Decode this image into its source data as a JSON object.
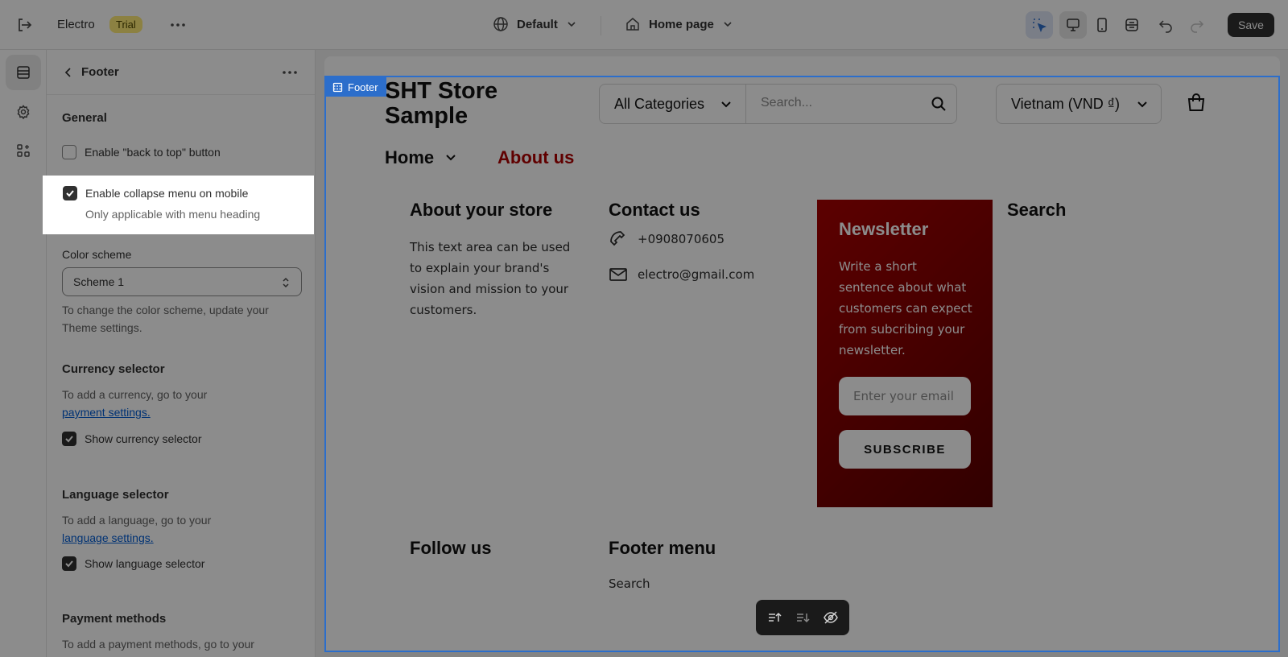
{
  "topbar": {
    "store_name": "Electro",
    "trial_badge": "Trial",
    "theme_label": "Default",
    "page_label": "Home page",
    "save_label": "Save"
  },
  "panel": {
    "title": "Footer",
    "general_heading": "General",
    "back_to_top_label": "Enable \"back to top\" button",
    "collapse_label": "Enable collapse menu on mobile",
    "collapse_hint": "Only applicable with menu heading",
    "color_scheme_label": "Color scheme",
    "color_scheme_value": "Scheme 1",
    "color_scheme_hint": "To change the color scheme, update your Theme settings.",
    "currency_heading": "Currency selector",
    "currency_hint": "To add a currency, go to your",
    "currency_link": "payment settings.",
    "show_currency_label": "Show currency selector",
    "language_heading": "Language selector",
    "language_hint": "To add a language, go to your",
    "language_link": "language settings.",
    "show_language_label": "Show language selector",
    "payment_heading": "Payment methods",
    "payment_hint": "To add a payment methods, go to your"
  },
  "preview": {
    "store_name": "SHT Store Sample",
    "categories_label": "All Categories",
    "search_placeholder": "Search...",
    "currency_label": "Vietnam (VND ₫)",
    "nav_home": "Home",
    "nav_about": "About us",
    "about_heading": "About your store",
    "about_text": "This text area can be used to explain your brand's vision and mission to your customers.",
    "contact_heading": "Contact us",
    "phone": "+0908070605",
    "email": "electro@gmail.com",
    "newsletter_heading": "Newsletter",
    "newsletter_text": "Write a short sentence about what customers can expect from subcribing your newsletter.",
    "newsletter_placeholder": "Enter your email",
    "subscribe_label": "SUBSCRIBE",
    "search_heading": "Search",
    "follow_heading": "Follow us",
    "footer_menu_heading": "Footer menu",
    "footer_menu_item": "Search"
  },
  "selection_tag": "Footer",
  "colors": {
    "accent": "#2c6ecb",
    "newsletter_bg": "#a80000",
    "about_link": "#b00000"
  }
}
